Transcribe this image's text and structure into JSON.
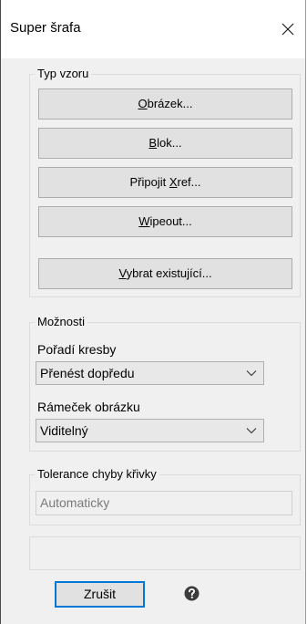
{
  "window": {
    "title": "Super šrafa",
    "close_icon": "close-icon"
  },
  "pattern_type": {
    "title": "Typ vzoru",
    "buttons": [
      {
        "accel": "O",
        "rest": "brázek..."
      },
      {
        "accel": "B",
        "rest": "lok..."
      },
      {
        "pre": "Připojit ",
        "accel": "X",
        "rest": "ref..."
      },
      {
        "accel": "W",
        "rest": "ipeout..."
      },
      {
        "accel": "V",
        "rest": "ybrat existující..."
      }
    ]
  },
  "options": {
    "title": "Možnosti",
    "draw_order_label": "Pořadí kresby",
    "draw_order_value": "Přenést dopředu",
    "image_frame_label": "Rámeček obrázku",
    "image_frame_value": "Viditelný"
  },
  "curve_tolerance": {
    "title": "Tolerance chyby křivky",
    "value": "Automaticky"
  },
  "footer": {
    "cancel_label": "Zrušit",
    "help_icon": "help-icon"
  }
}
